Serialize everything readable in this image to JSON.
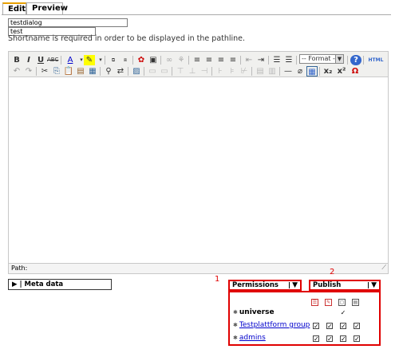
{
  "tabs": [
    {
      "label": "Edit",
      "active": true
    },
    {
      "label": "Preview",
      "active": false
    }
  ],
  "fields": {
    "title_value": "testdialog",
    "shortname_value": "test",
    "hint": "Shortname is required in order to be displayed in the pathline."
  },
  "toolbar": {
    "format_label": "-- Format --"
  },
  "editor": {
    "status_label": "Path:"
  },
  "meta_button": {
    "label": "▶ | Meta data"
  },
  "permissions": {
    "label": "Permissions",
    "marker": "1"
  },
  "publish": {
    "label": "Publish",
    "marker": "2"
  },
  "permission_rows": [
    {
      "label": "universe",
      "link": false,
      "checks": [
        false,
        false,
        true,
        false
      ]
    },
    {
      "label": "Testplattform group",
      "link": true,
      "checks": [
        true,
        true,
        true,
        true
      ]
    },
    {
      "label": "admins",
      "link": true,
      "checks": [
        true,
        true,
        true,
        true
      ]
    }
  ],
  "colors": {
    "highlight": "#e00000",
    "tab_accent": "#e8a000",
    "link": "#0000cc"
  },
  "icons": [
    "bold-icon",
    "italic-icon",
    "underline-icon",
    "strikethrough-icon",
    "font-color-icon",
    "highlight-color-icon",
    "select-all-icon",
    "cleanup-icon",
    "insert-table-icon",
    "edit-table-icon",
    "link-icon",
    "unlink-icon",
    "align-left-icon",
    "align-center-icon",
    "align-right-icon",
    "align-justify-icon",
    "outdent-icon",
    "indent-icon",
    "unordered-list-icon",
    "ordered-list-icon",
    "help-icon",
    "html-icon",
    "undo-icon",
    "redo-icon",
    "cut-icon",
    "copy-icon",
    "paste-icon",
    "paste-text-icon",
    "paste-word-icon",
    "find-icon",
    "replace-icon",
    "fullscreen-icon",
    "horizontal-rule-icon",
    "remove-format-icon",
    "subscript-icon",
    "superscript-icon",
    "special-char-icon"
  ]
}
